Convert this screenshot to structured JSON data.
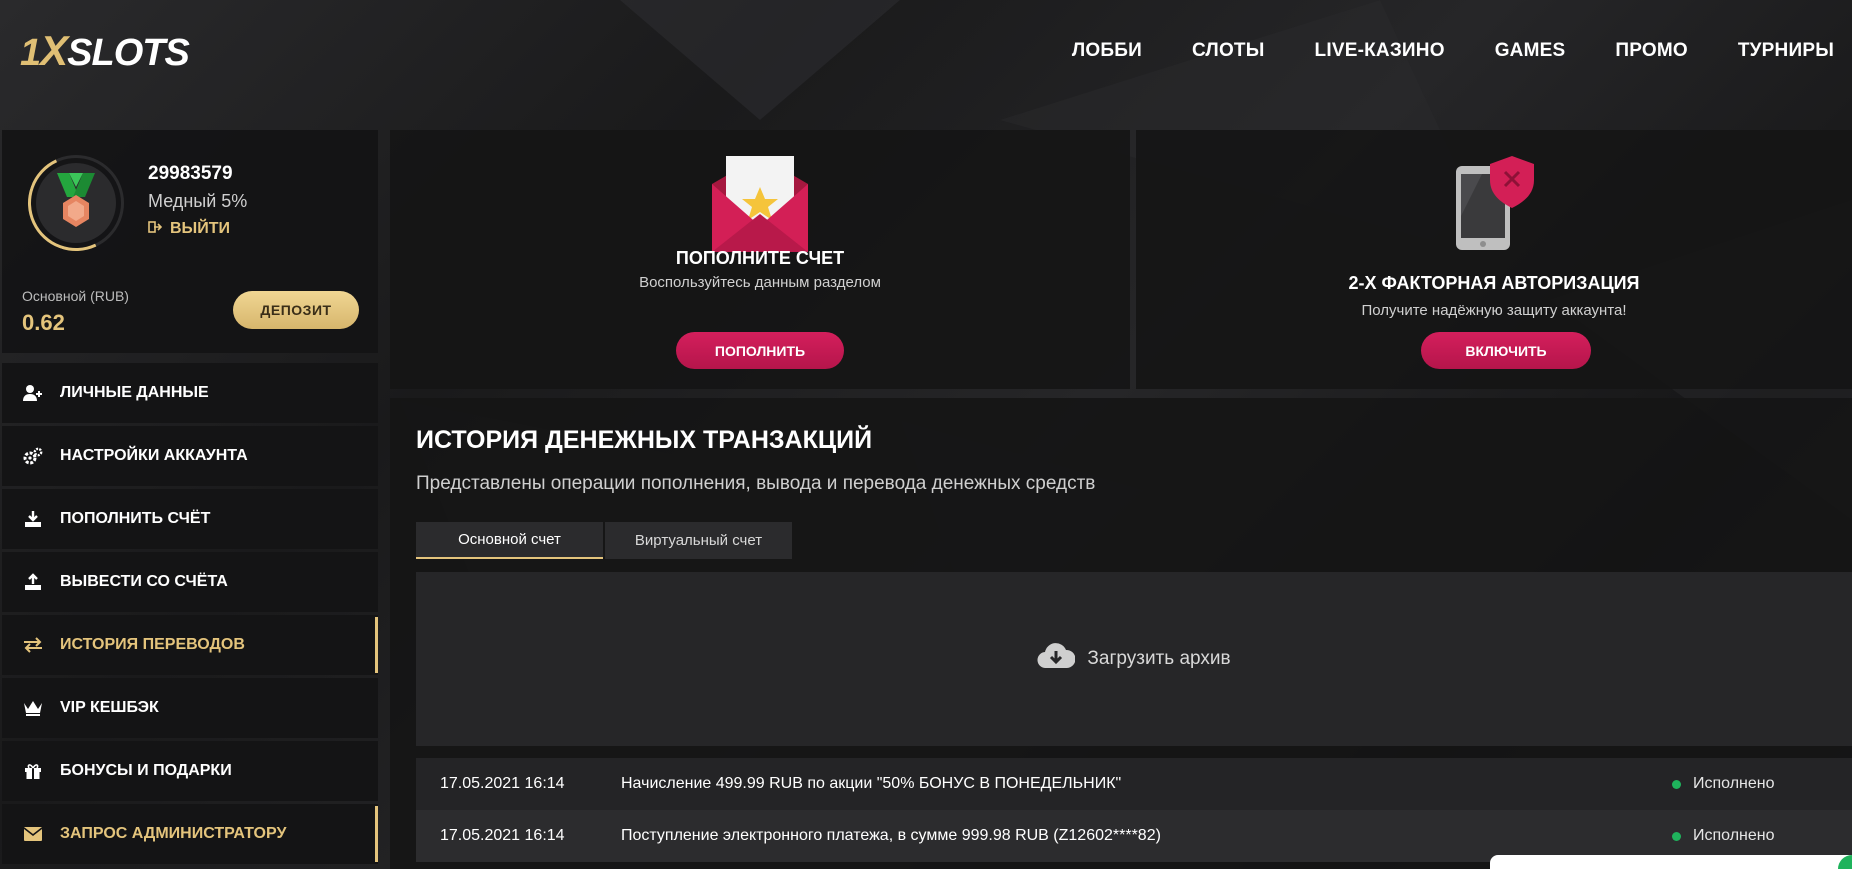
{
  "brand": {
    "one": "1",
    "x": "X",
    "slots": "SLOTS",
    "accent": "#e4c47c"
  },
  "nav": [
    {
      "label": "ЛОББИ"
    },
    {
      "label": "СЛОТЫ"
    },
    {
      "label": "LIVE-КАЗИНО"
    },
    {
      "label": "GAMES"
    },
    {
      "label": "ПРОМО"
    },
    {
      "label": "ТУРНИРЫ"
    }
  ],
  "profile": {
    "user_id": "29983579",
    "level": "Медный 5%",
    "logout_label": "ВЫЙТИ",
    "balance_label": "Основной (RUB)",
    "balance_value": "0.62",
    "deposit_label": "ДЕПОЗИТ"
  },
  "menu": [
    {
      "label": "ЛИЧНЫЕ ДАННЫЕ",
      "icon": "user-plus-icon"
    },
    {
      "label": "НАСТРОЙКИ АККАУНТА",
      "icon": "gears-icon"
    },
    {
      "label": "ПОПОЛНИТЬ СЧЁТ",
      "icon": "download-icon"
    },
    {
      "label": "ВЫВЕСТИ СО СЧЁТА",
      "icon": "upload-icon"
    },
    {
      "label": "ИСТОРИЯ ПЕРЕВОДОВ",
      "icon": "transfer-icon",
      "active": true
    },
    {
      "label": "VIP КЕШБЭК",
      "icon": "crown-icon"
    },
    {
      "label": "БОНУСЫ И ПОДАРКИ",
      "icon": "gift-icon"
    },
    {
      "label": "ЗАПРОС АДМИНИСТРАТОРУ",
      "icon": "envelope-icon"
    }
  ],
  "cards": {
    "deposit": {
      "title": "ПОПОЛНИТЕ СЧЕТ",
      "subtitle": "Воспользуйтесь данным разделом",
      "button": "ПОПОЛНИТЬ"
    },
    "twofa": {
      "title": "2-Х ФАКТОРНАЯ АВТОРИЗАЦИЯ",
      "subtitle": "Получите надёжную защиту аккаунта!",
      "button": "ВКЛЮЧИТЬ"
    }
  },
  "history": {
    "title": "ИСТОРИЯ ДЕНЕЖНЫХ ТРАНЗАКЦИЙ",
    "subtitle": "Представлены операции пополнения, вывода и перевода денежных средств",
    "tabs": [
      {
        "label": "Основной счет",
        "active": true
      },
      {
        "label": "Виртуальный счет"
      }
    ],
    "archive_label": "Загрузить архив",
    "rows": [
      {
        "date": "17.05.2021 16:14",
        "description": "Начисление 499.99 RUB по акции \"50% БОНУС В ПОНЕДЕЛЬНИК\"",
        "status": "Исполнено"
      },
      {
        "date": "17.05.2021 16:14",
        "description": "Поступление электронного платежа, в сумме 999.98 RUB (Z12602****82)",
        "status": "Исполнено"
      }
    ]
  },
  "colors": {
    "accent": "#e4c47c",
    "pink": "#c81a54",
    "success": "#1fb35c"
  }
}
